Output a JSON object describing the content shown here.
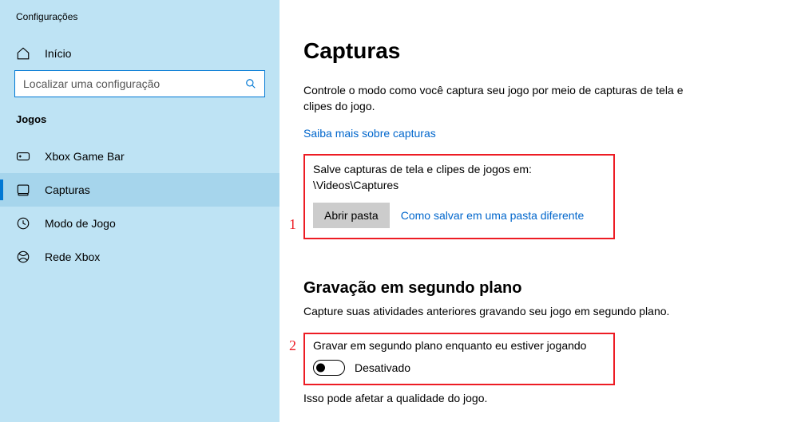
{
  "sidebar": {
    "title": "Configurações",
    "home": "Início",
    "search_placeholder": "Localizar uma configuração",
    "category": "Jogos",
    "items": [
      {
        "label": "Xbox Game Bar"
      },
      {
        "label": "Capturas"
      },
      {
        "label": "Modo de Jogo"
      },
      {
        "label": "Rede Xbox"
      }
    ]
  },
  "main": {
    "title": "Capturas",
    "desc": "Controle o modo como você captura seu jogo por meio de capturas de tela e clipes do jogo.",
    "learn_more": "Saiba mais sobre capturas",
    "save_label": "Salve capturas de tela e clipes de jogos em:",
    "save_path": "\\Videos\\Captures",
    "open_folder": "Abrir pasta",
    "how_save": "Como salvar em uma pasta diferente",
    "bg_title": "Gravação em segundo plano",
    "bg_desc": "Capture suas atividades anteriores gravando seu jogo em segundo plano.",
    "bg_toggle_label": "Gravar em segundo plano enquanto eu estiver jogando",
    "bg_toggle_state": "Desativado",
    "bg_note": "Isso pode afetar a qualidade do jogo."
  },
  "annot": {
    "one": "1",
    "two": "2"
  }
}
